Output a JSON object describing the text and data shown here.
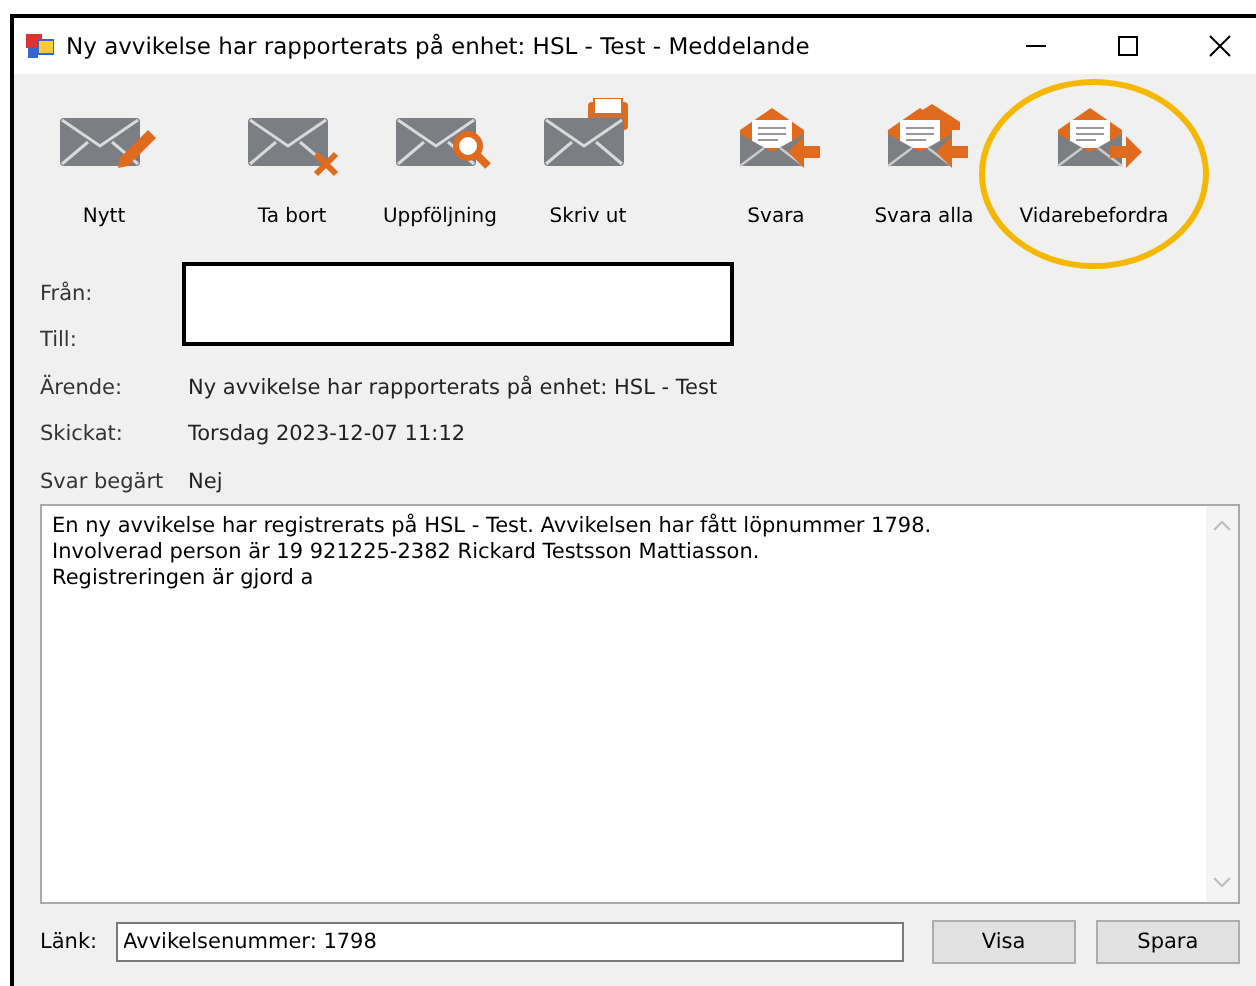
{
  "window": {
    "title": "Ny avvikelse har rapporterats på enhet: HSL - Test - Meddelande"
  },
  "toolbar": [
    {
      "label": "Nytt",
      "kind": "new"
    },
    {
      "label": "Ta bort",
      "kind": "delete"
    },
    {
      "label": "Uppföljning",
      "kind": "followup"
    },
    {
      "label": "Skriv ut",
      "kind": "print"
    },
    {
      "label": "Svara",
      "kind": "reply"
    },
    {
      "label": "Svara alla",
      "kind": "reply_all"
    },
    {
      "label": "Vidarebefordra",
      "kind": "forward",
      "highlighted": true
    }
  ],
  "header": [
    {
      "label": "Från:"
    },
    {
      "label": "Till:"
    },
    {
      "label": "Ärende:",
      "value": "Ny avvikelse har rapporterats på enhet: HSL - Test"
    },
    {
      "label": "Skickat:",
      "value": "Torsdag 2023-12-07 11:12"
    },
    {
      "label": "Svar begärt",
      "value": "Nej"
    }
  ],
  "body": [
    "En ny avvikelse har registrerats på HSL - Test. Avvikelsen har fått löpnummer 1798.",
    "Involverad person är 19 921225-2382  Rickard Testsson Mattiasson.",
    "Registreringen är gjord a"
  ],
  "link": {
    "label": "Länk:",
    "value": "Avvikelsenummer: 1798"
  },
  "buttons": [
    "Visa",
    "Spara"
  ]
}
